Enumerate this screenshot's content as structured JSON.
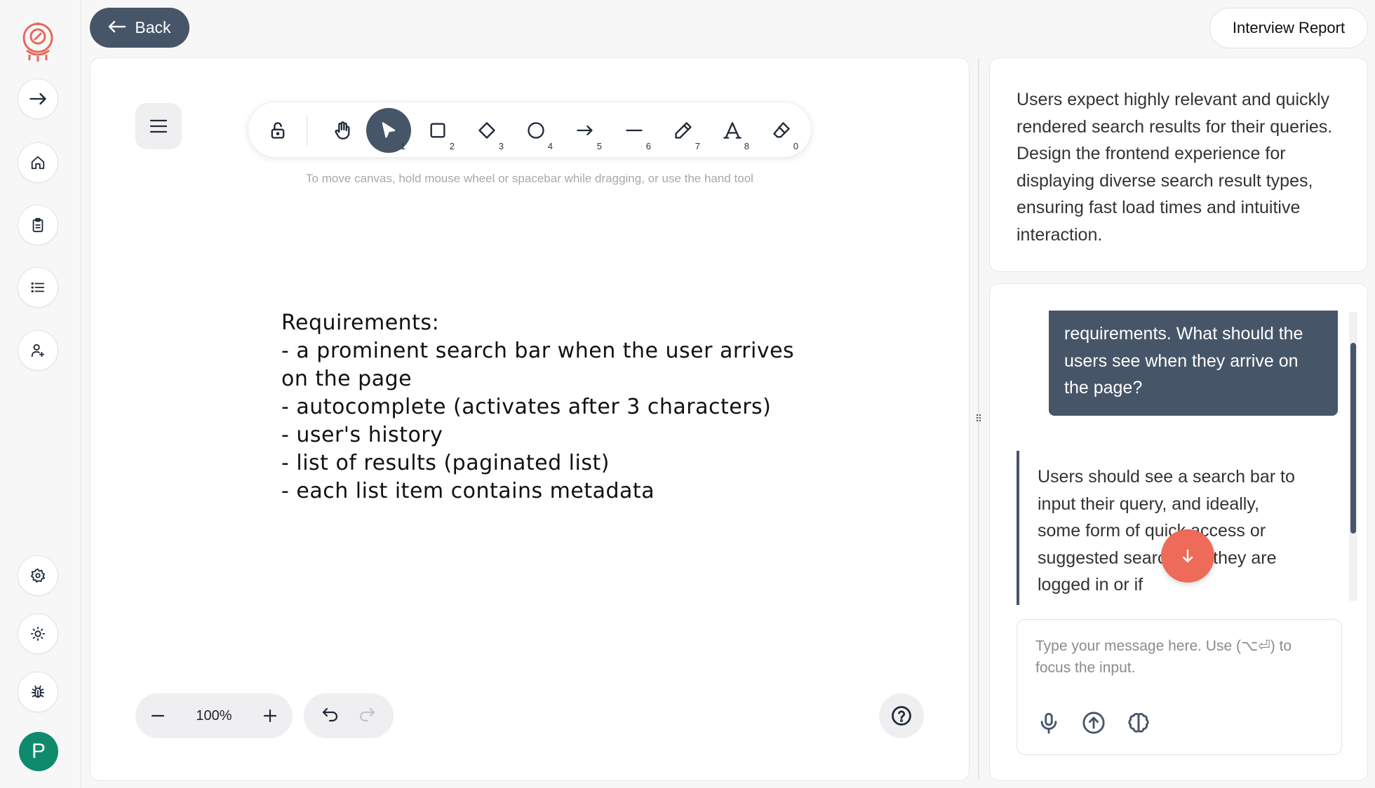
{
  "header": {
    "back_label": "Back",
    "report_label": "Interview Report"
  },
  "sidebar": {
    "items": [
      {
        "name": "logo-icon"
      },
      {
        "name": "arrow-right-icon"
      },
      {
        "name": "home-icon"
      },
      {
        "name": "clipboard-icon"
      },
      {
        "name": "list-icon"
      },
      {
        "name": "user-plus-icon"
      },
      {
        "name": "gear-icon"
      },
      {
        "name": "sun-icon"
      },
      {
        "name": "bug-icon"
      }
    ],
    "avatar_letter": "P",
    "avatar_color": "#0f8a6c"
  },
  "canvas": {
    "toolbar": {
      "tools": [
        {
          "name": "lock-icon",
          "key": ""
        },
        {
          "name": "hand-icon",
          "key": ""
        },
        {
          "name": "pointer-icon",
          "key": "1",
          "active": true
        },
        {
          "name": "rectangle-icon",
          "key": "2"
        },
        {
          "name": "diamond-icon",
          "key": "3"
        },
        {
          "name": "ellipse-icon",
          "key": "4"
        },
        {
          "name": "arrow-icon",
          "key": "5"
        },
        {
          "name": "line-icon",
          "key": "6"
        },
        {
          "name": "pencil-icon",
          "key": "7"
        },
        {
          "name": "text-icon",
          "key": "8"
        },
        {
          "name": "eraser-icon",
          "key": "0"
        }
      ]
    },
    "hint": "To move canvas, hold mouse wheel or spacebar while dragging, or use the hand tool",
    "notes": [
      "Requirements:",
      "- a prominent search bar when the user arrives",
      "on the page",
      "- autocomplete (activates after 3 characters)",
      "- user's history",
      "- list of results (paginated list)",
      "- each list item contains metadata"
    ],
    "zoom": "100%"
  },
  "task": {
    "text": "Users expect highly relevant and quickly rendered search results for their queries. Design the frontend experience for displaying diverse search result types, ensuring fast load times and intuitive interaction."
  },
  "chat": {
    "user_message": "requirements. What should the users see when they arrive on the page?",
    "ai_message": "Users should see a search bar to input their query, and ideally, some form of quick access or suggested searches if they are logged in or if",
    "input_placeholder": "Type your message here. Use (⌥⏎) to focus the input.",
    "accent": "#475569",
    "scroll_button_color": "#ee6a59"
  }
}
